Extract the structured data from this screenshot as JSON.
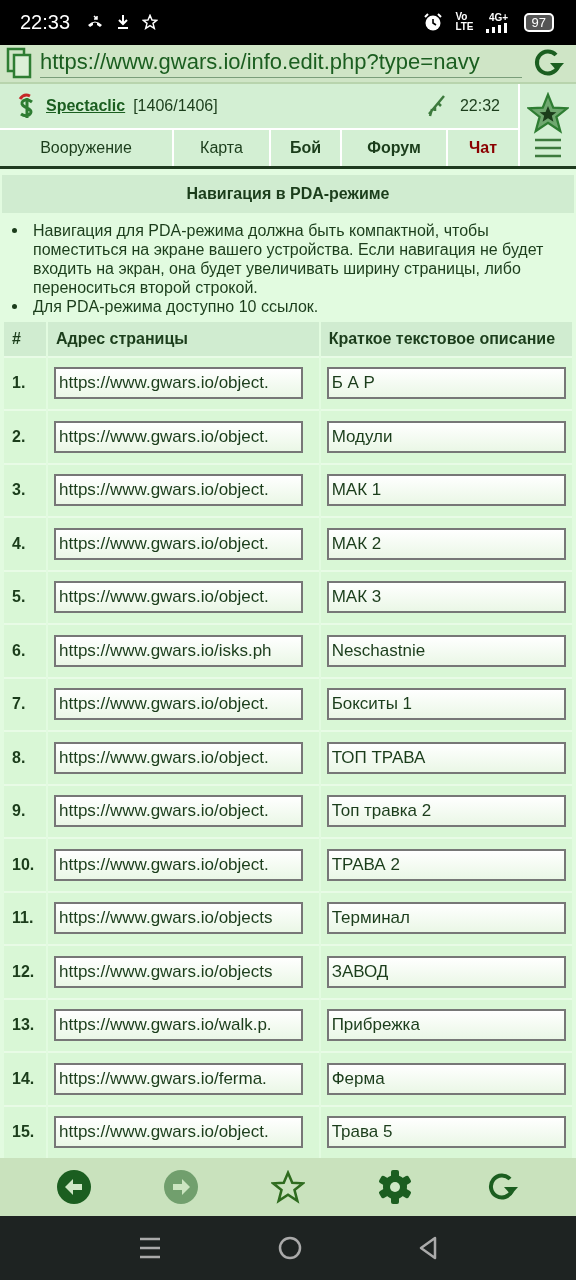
{
  "status_bar": {
    "time": "22:33",
    "volte_top": "Vo",
    "volte_bottom": "LTE",
    "network": "4G+",
    "battery": "97"
  },
  "address_bar": {
    "url": "https://www.gwars.io/info.edit.php?type=navy"
  },
  "header": {
    "user": "Spectaclic",
    "hp": "[1406/1406]",
    "time": "22:32"
  },
  "tabs": [
    {
      "label": "Вооружение",
      "kind": "normal"
    },
    {
      "label": "Карта",
      "kind": "normal"
    },
    {
      "label": "Бой",
      "kind": "bold"
    },
    {
      "label": "Форум",
      "kind": "bold"
    },
    {
      "label": "Чат",
      "kind": "alert"
    }
  ],
  "panel": {
    "title": "Навигация в PDA-режиме",
    "notes": [
      "Навигация для PDA-режима должна быть компактной, чтобы поместиться на экране вашего устройства. Если навигация не будет входить на экран, она будет увеличивать ширину страницы, либо переноситься второй строкой.",
      "Для PDA-режима доступно 10 ссылок."
    ]
  },
  "table": {
    "columns": [
      "#",
      "Адрес страницы",
      "Краткое текстовое описание"
    ],
    "rows": [
      {
        "num": "1.",
        "url": "https://www.gwars.io/object.",
        "desc": "Б А Р"
      },
      {
        "num": "2.",
        "url": "https://www.gwars.io/object.",
        "desc": "Модули"
      },
      {
        "num": "3.",
        "url": "https://www.gwars.io/object.",
        "desc": "МАК 1"
      },
      {
        "num": "4.",
        "url": "https://www.gwars.io/object.",
        "desc": "МАК 2"
      },
      {
        "num": "5.",
        "url": "https://www.gwars.io/object.",
        "desc": "МАК 3"
      },
      {
        "num": "6.",
        "url": "https://www.gwars.io/isks.ph",
        "desc": "Neschastnie"
      },
      {
        "num": "7.",
        "url": "https://www.gwars.io/object.",
        "desc": "Бокситы 1"
      },
      {
        "num": "8.",
        "url": "https://www.gwars.io/object.",
        "desc": "ТОП ТРАВА"
      },
      {
        "num": "9.",
        "url": "https://www.gwars.io/object.",
        "desc": "Топ травка 2"
      },
      {
        "num": "10.",
        "url": "https://www.gwars.io/object.",
        "desc": "ТРАВА 2"
      },
      {
        "num": "11.",
        "url": "https://www.gwars.io/objects",
        "desc": "Терминал"
      },
      {
        "num": "12.",
        "url": "https://www.gwars.io/objects",
        "desc": "ЗАВОД"
      },
      {
        "num": "13.",
        "url": "https://www.gwars.io/walk.p.",
        "desc": "Прибрежка"
      },
      {
        "num": "14.",
        "url": "https://www.gwars.io/ferma.",
        "desc": "Ферма"
      },
      {
        "num": "15.",
        "url": "https://www.gwars.io/object.",
        "desc": "Трава 5"
      }
    ]
  },
  "toolbar": {
    "forward_disabled": true
  }
}
